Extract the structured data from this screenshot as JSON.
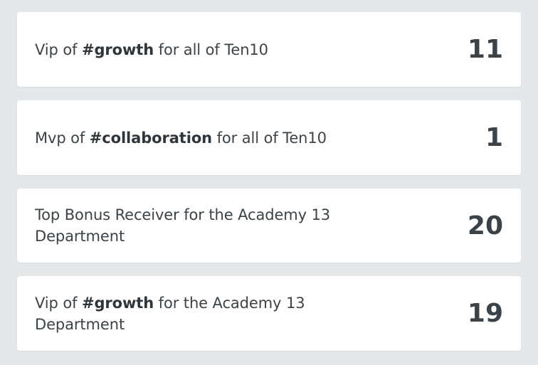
{
  "awards": [
    {
      "prefix": "Vip of ",
      "tag": "#growth",
      "suffix": " for all of Ten10",
      "count": "11"
    },
    {
      "prefix": "Mvp of ",
      "tag": "#collaboration",
      "suffix": " for all of Ten10",
      "count": "1"
    },
    {
      "prefix": "Top Bonus Receiver for the Academy 13 Department",
      "tag": "",
      "suffix": "",
      "count": "20"
    },
    {
      "prefix": "Vip of ",
      "tag": "#growth",
      "suffix": " for the Academy 13 Department",
      "count": "19"
    }
  ]
}
